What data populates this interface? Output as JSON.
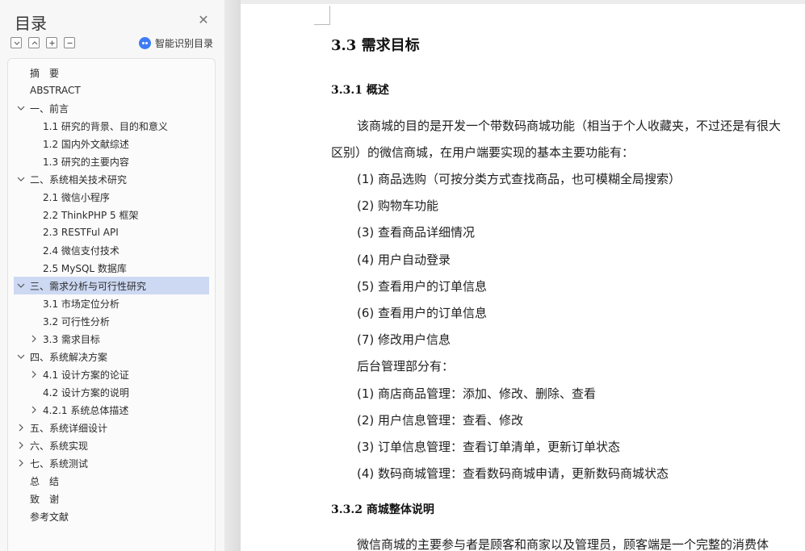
{
  "nav": {
    "title": "目录",
    "smart_toc_label": "智能识别目录",
    "toolbar_icons": [
      "collapse-all-icon",
      "expand-all-icon",
      "add-heading-icon",
      "remove-heading-icon"
    ],
    "items": [
      {
        "label": "摘　要",
        "level": 0,
        "chevron": "none"
      },
      {
        "label": "ABSTRACT",
        "level": 0,
        "chevron": "none"
      },
      {
        "label": "一、前言",
        "level": 0,
        "chevron": "down"
      },
      {
        "label": "1.1 研究的背景、目的和意义",
        "level": 1,
        "chevron": "none"
      },
      {
        "label": "1.2 国内外文献综述",
        "level": 1,
        "chevron": "none"
      },
      {
        "label": "1.3 研究的主要内容",
        "level": 1,
        "chevron": "none"
      },
      {
        "label": "二、系统相关技术研究",
        "level": 0,
        "chevron": "down"
      },
      {
        "label": "2.1 微信小程序",
        "level": 1,
        "chevron": "none"
      },
      {
        "label": "2.2 ThinkPHP 5 框架",
        "level": 1,
        "chevron": "none"
      },
      {
        "label": "2.3 RESTFul API",
        "level": 1,
        "chevron": "none"
      },
      {
        "label": "2.4 微信支付技术",
        "level": 1,
        "chevron": "none"
      },
      {
        "label": "2.5 MySQL 数据库",
        "level": 1,
        "chevron": "none"
      },
      {
        "label": "三、需求分析与可行性研究",
        "level": 0,
        "chevron": "down",
        "selected": true
      },
      {
        "label": "3.1 市场定位分析",
        "level": 1,
        "chevron": "none"
      },
      {
        "label": "3.2 可行性分析",
        "level": 1,
        "chevron": "none"
      },
      {
        "label": "3.3 需求目标",
        "level": 1,
        "chevron": "right"
      },
      {
        "label": "四、系统解决方案",
        "level": 0,
        "chevron": "down"
      },
      {
        "label": "4.1 设计方案的论证",
        "level": 1,
        "chevron": "right"
      },
      {
        "label": "4.2 设计方案的说明",
        "level": 1,
        "chevron": "none"
      },
      {
        "label": "4.2.1 系统总体描述",
        "level": 1,
        "chevron": "right"
      },
      {
        "label": "五、系统详细设计",
        "level": 0,
        "chevron": "right"
      },
      {
        "label": "六、系统实现",
        "level": 0,
        "chevron": "right"
      },
      {
        "label": "七、系统测试",
        "level": 0,
        "chevron": "right"
      },
      {
        "label": "总　结",
        "level": 0,
        "chevron": "none"
      },
      {
        "label": "致　谢",
        "level": 0,
        "chevron": "none"
      },
      {
        "label": "参考文献",
        "level": 0,
        "chevron": "none"
      }
    ]
  },
  "doc": {
    "heading": "3.3  需求目标",
    "sub1": "3.3.1  概述",
    "intro_line1": "该商城的目的是开发一个带数码商城功能（相当于个人收藏夹，不过还是有很大",
    "intro_line2": "区别）的微信商城，在用户端要实现的基本主要功能有：",
    "user_features": [
      "(1)  商品选购（可按分类方式查找商品，也可模糊全局搜索）",
      "(2)  购物车功能",
      "(3)  查看商品详细情况",
      "(4)  用户自动登录",
      "(5)  查看用户的订单信息",
      "(6)  查看用户的订单信息",
      "(7)  修改用户信息"
    ],
    "admin_intro": "后台管理部分有：",
    "admin_features": [
      "(1)  商店商品管理：添加、修改、删除、查看",
      "(2)  用户信息管理：查看、修改",
      "(3)  订单信息管理：查看订单清单，更新订单状态",
      "(4)  数码商城管理：查看数码商城申请，更新数码商城状态"
    ],
    "sub2": "3.3.2  商城整体说明",
    "closing_line": "微信商城的主要参与者是顾客和商家以及管理员，顾客端是一个完整的消费体"
  }
}
